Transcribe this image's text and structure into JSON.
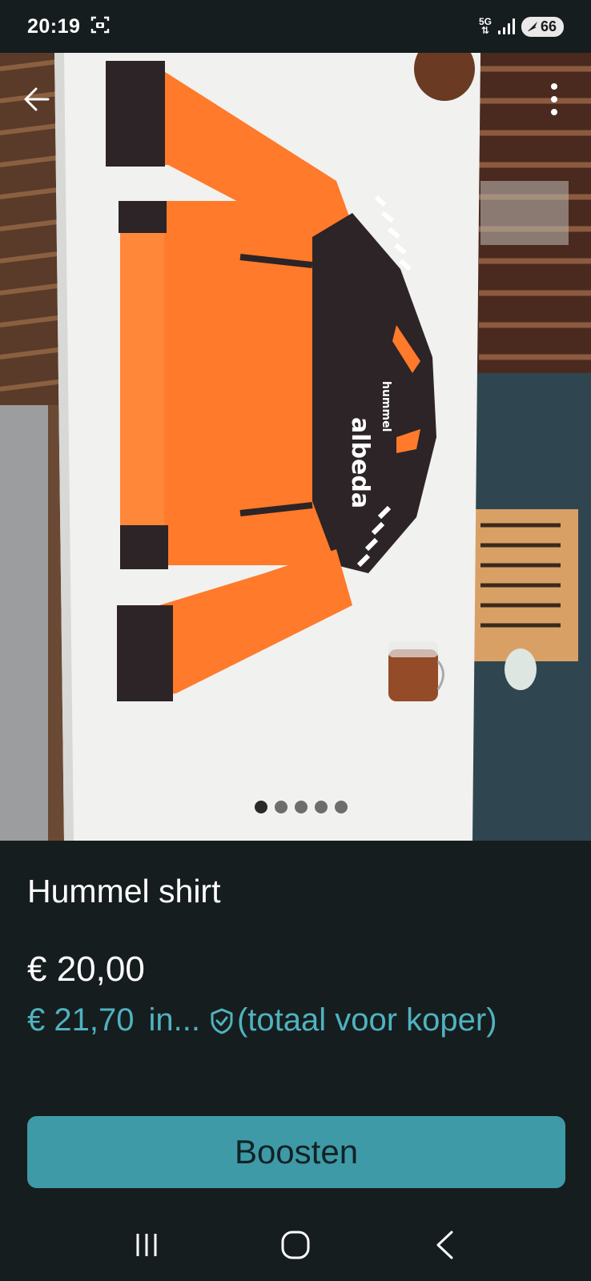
{
  "status_bar": {
    "time": "20:19",
    "network": "5G",
    "battery": "66",
    "icons": [
      "screenshot-icon",
      "signal-icon",
      "battery-icon"
    ]
  },
  "photo": {
    "icons": [
      "back-arrow-icon",
      "more-vertical-icon"
    ],
    "page_count": 5,
    "active_page": 1,
    "garment_print_brand": "hummel",
    "garment_print_club": "albeda"
  },
  "listing": {
    "title": "Hummel shirt",
    "price": "€ 20,00",
    "total_price": "€ 21,70",
    "total_suffix": "in...",
    "total_note": "(totaal voor koper)"
  },
  "boost_button": {
    "label": "Boosten"
  },
  "nav": {
    "icons": [
      "recent-apps-icon",
      "home-icon",
      "back-icon"
    ]
  },
  "colors": {
    "background": "#161d1f",
    "accent": "#4fb3bf",
    "button": "#3e9aa6",
    "shirt_orange": "#ff7a2a",
    "shirt_dark": "#2c2426"
  }
}
